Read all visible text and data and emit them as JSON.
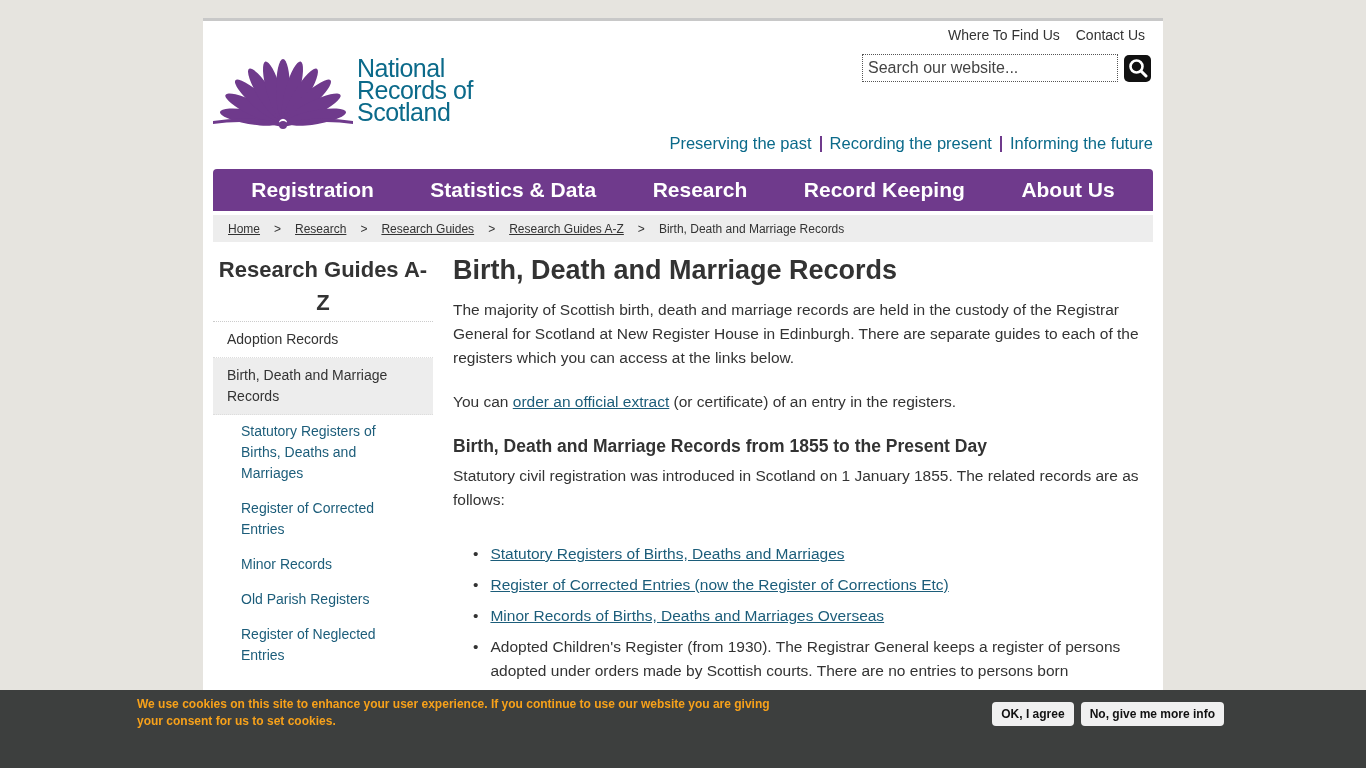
{
  "header": {
    "utility_links": [
      "Where To Find Us",
      "Contact Us"
    ],
    "logo_text": [
      "National",
      "Records of",
      "Scotland"
    ],
    "search": {
      "placeholder": "Search our website..."
    },
    "tagline": [
      "Preserving the past",
      "Recording the present",
      "Informing the future"
    ]
  },
  "nav": {
    "items": [
      "Registration",
      "Statistics & Data",
      "Research",
      "Record Keeping",
      "About Us"
    ]
  },
  "breadcrumb": [
    {
      "label": "Home",
      "kind": "link"
    },
    {
      "label": "Research",
      "kind": "link"
    },
    {
      "label": "Research Guides",
      "kind": "link"
    },
    {
      "label": "Research Guides A-Z",
      "kind": "link"
    },
    {
      "label": "Birth, Death and Marriage Records",
      "kind": "current"
    }
  ],
  "breadcrumb_separator": ">",
  "sidebar": {
    "title": "Research Guides A-Z",
    "items": [
      {
        "label": "Adoption Records",
        "selected": false
      },
      {
        "label": "Birth, Death and Marriage Records",
        "selected": true,
        "children": [
          {
            "label": "Statutory Registers of Births, Deaths and Marriages",
            "selected": false
          },
          {
            "label": "Register of Corrected Entries",
            "selected": false
          },
          {
            "label": "Minor Records",
            "selected": false
          },
          {
            "label": "Old Parish Registers",
            "selected": false
          },
          {
            "label": "Register of Neglected Entries",
            "selected": false
          }
        ]
      }
    ]
  },
  "article": {
    "title": "Birth, Death and Marriage Records",
    "blocks": [
      {
        "kind": "paragraph",
        "text": "The majority of Scottish birth, death and marriage records are held in the custody of the Registrar General for Scotland at New Register House in Edinburgh.  There are separate guides to each of the registers which you can access at the links below."
      },
      {
        "kind": "paragraph_link",
        "before": "You can ",
        "link": "order an official extract",
        "after": " (or certificate) of an entry in the registers."
      },
      {
        "kind": "heading",
        "text": "Birth, Death and Marriage Records from 1855 to the Present Day"
      },
      {
        "kind": "paragraph",
        "text": "Statutory civil registration was introduced in Scotland on 1 January 1855.  The related records are as follows:"
      },
      {
        "kind": "list",
        "marker": "•",
        "items": [
          {
            "kind": "link",
            "text": "Statutory Registers of Births, Deaths and Marriages"
          },
          {
            "kind": "link",
            "text": "Register of Corrected Entries (now the Register of Corrections Etc)"
          },
          {
            "kind": "link",
            "text": "Minor Records of Births, Deaths and Marriages Overseas"
          },
          {
            "kind": "text",
            "text": "Adopted Children's Register (from 1930). The Registrar General keeps a register of persons adopted under orders made by Scottish courts. There are no entries to persons born"
          }
        ]
      }
    ]
  },
  "cookie_bar": {
    "message": "We use cookies on this site to enhance your user experience. If you continue to use our website you are giving your consent for us to set cookies.",
    "buttons": [
      "OK, I agree",
      "No, give me more info"
    ]
  }
}
